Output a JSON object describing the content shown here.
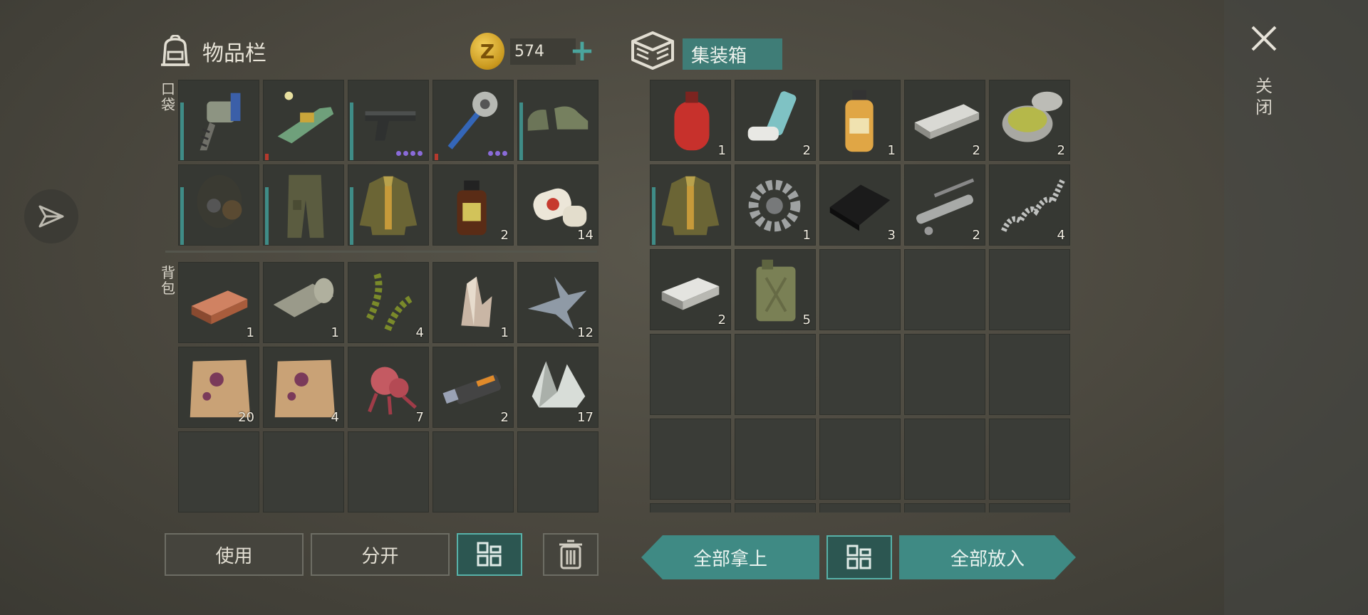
{
  "inventory": {
    "title": "物品栏",
    "coins": "574",
    "coin_symbol": "Z",
    "add_coins": "+",
    "pockets_label": "口袋",
    "backpack_label": "背包",
    "pocket_items": [
      {
        "name": "drill-icon",
        "count": "",
        "durability": "high",
        "dots": 0
      },
      {
        "name": "plasma-gun-icon",
        "count": "",
        "durability": "low",
        "dots": 0
      },
      {
        "name": "pistol-icon",
        "count": "",
        "durability": "high",
        "dots": 4
      },
      {
        "name": "saw-mace-icon",
        "count": "",
        "durability": "low",
        "dots": 3
      },
      {
        "name": "boots-icon",
        "count": "",
        "durability": "high",
        "dots": 0
      },
      {
        "name": "gas-mask-icon",
        "count": "",
        "durability": "high",
        "dots": 0
      },
      {
        "name": "cargo-pants-icon",
        "count": "",
        "durability": "high",
        "dots": 0
      },
      {
        "name": "jacket-icon",
        "count": "",
        "durability": "high",
        "dots": 0
      },
      {
        "name": "medicine-bottle-icon",
        "count": "2",
        "durability": "",
        "dots": 0
      },
      {
        "name": "bandage-icon",
        "count": "14",
        "durability": "",
        "dots": 0
      }
    ],
    "backpack_items": [
      {
        "name": "copper-ingot-icon",
        "count": "1"
      },
      {
        "name": "cloth-roll-icon",
        "count": "1"
      },
      {
        "name": "herb-icon",
        "count": "4"
      },
      {
        "name": "crystal-icon",
        "count": "1"
      },
      {
        "name": "metal-shards-icon",
        "count": "12"
      },
      {
        "name": "leather-hide-icon",
        "count": "20"
      },
      {
        "name": "leather-hide-icon",
        "count": "4"
      },
      {
        "name": "mutant-organ-icon",
        "count": "7"
      },
      {
        "name": "usb-drive-icon",
        "count": "2"
      },
      {
        "name": "quartz-icon",
        "count": "17"
      },
      {
        "name": "empty",
        "count": ""
      },
      {
        "name": "empty",
        "count": ""
      },
      {
        "name": "empty",
        "count": ""
      },
      {
        "name": "empty",
        "count": ""
      },
      {
        "name": "empty",
        "count": ""
      }
    ],
    "buttons": {
      "use": "使用",
      "split": "分开"
    }
  },
  "container": {
    "title": "集装箱",
    "items": [
      {
        "name": "gas-cylinder-icon",
        "count": "1",
        "durability": ""
      },
      {
        "name": "inhaler-icon",
        "count": "2",
        "durability": ""
      },
      {
        "name": "oil-bottle-icon",
        "count": "1",
        "durability": ""
      },
      {
        "name": "steel-bar-icon",
        "count": "2",
        "durability": ""
      },
      {
        "name": "glue-jar-icon",
        "count": "2",
        "durability": ""
      },
      {
        "name": "jacket-icon",
        "count": "",
        "durability": "high"
      },
      {
        "name": "gear-icon",
        "count": "1",
        "durability": ""
      },
      {
        "name": "black-cloth-icon",
        "count": "3",
        "durability": ""
      },
      {
        "name": "pipe-parts-icon",
        "count": "2",
        "durability": ""
      },
      {
        "name": "spring-icon",
        "count": "4",
        "durability": ""
      },
      {
        "name": "silver-ingot-icon",
        "count": "2",
        "durability": ""
      },
      {
        "name": "jerrycan-icon",
        "count": "5",
        "durability": ""
      }
    ],
    "buttons": {
      "take_all": "全部拿上",
      "put_all": "全部放入"
    }
  },
  "close_label": "关闭",
  "colors": {
    "accent": "#3f8a84",
    "durability": "#3f8c87",
    "durability_low": "#b5392d",
    "slot": "#363833"
  }
}
